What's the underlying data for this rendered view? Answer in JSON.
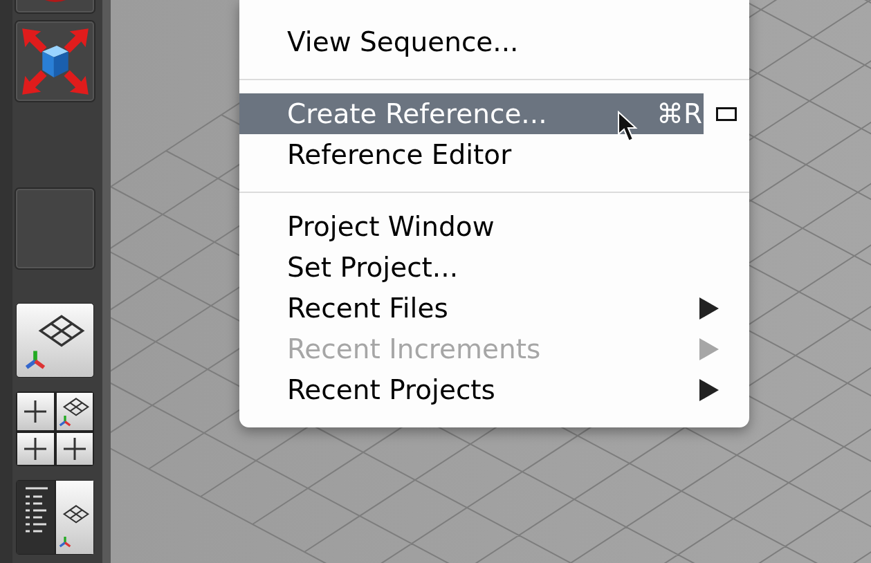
{
  "menu": {
    "items": [
      {
        "kind": "item",
        "label": "View Sequence...",
        "selected": false,
        "disabled": false
      },
      {
        "kind": "separator"
      },
      {
        "kind": "item",
        "label": "Create Reference...",
        "shortcut": "⌘R",
        "option_box": true,
        "selected": true,
        "disabled": false
      },
      {
        "kind": "item",
        "label": "Reference Editor",
        "selected": false,
        "disabled": false
      },
      {
        "kind": "separator"
      },
      {
        "kind": "item",
        "label": "Project Window",
        "selected": false,
        "disabled": false
      },
      {
        "kind": "item",
        "label": "Set Project...",
        "selected": false,
        "disabled": false
      },
      {
        "kind": "item",
        "label": "Recent Files",
        "submenu": true,
        "selected": false,
        "disabled": false
      },
      {
        "kind": "item",
        "label": "Recent Increments",
        "submenu": true,
        "selected": false,
        "disabled": true
      },
      {
        "kind": "item",
        "label": "Recent Projects",
        "submenu": true,
        "selected": false,
        "disabled": false
      }
    ]
  }
}
